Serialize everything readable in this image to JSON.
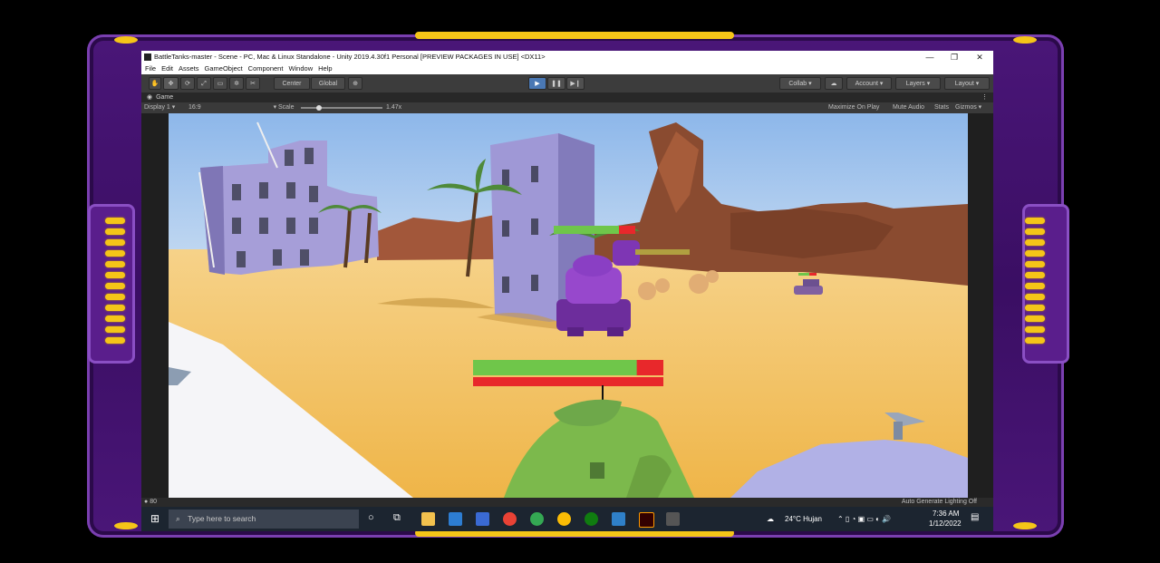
{
  "window": {
    "title": "BattleTanks-master - Scene - PC, Mac & Linux Standalone - Unity 2019.4.30f1 Personal [PREVIEW PACKAGES IN USE] <DX11>",
    "minimize": "—",
    "maximize": "❐",
    "close": "✕"
  },
  "menu": [
    "File",
    "Edit",
    "Assets",
    "GameObject",
    "Component",
    "Window",
    "Help"
  ],
  "toolbar": {
    "pivot_center": "Center",
    "pivot_global": "Global",
    "collab": "Collab",
    "account": "Account",
    "layers": "Layers",
    "layout": "Layout"
  },
  "game_view": {
    "tab_label": "Game",
    "display": "Display 1",
    "aspect": "16:9",
    "scale_label": "Scale",
    "scale_value": "1.47x",
    "maximize_on_play": "Maximize On Play",
    "mute_audio": "Mute Audio",
    "stats": "Stats",
    "gizmos": "Gizmos"
  },
  "hud": {
    "player_health_fraction": 0.86,
    "enemy_health_fraction": 0.8
  },
  "status": {
    "count": "80",
    "lighting": "Auto Generate Lighting Off"
  },
  "taskbar": {
    "search_placeholder": "Type here to search",
    "weather": "24°C  Hujan",
    "time": "7:36 AM",
    "date": "1/12/2022"
  },
  "colors": {
    "frame_purple": "#4a1678",
    "frame_gold": "#f5c518",
    "sky": "#9fc3ee",
    "sand": "#f3c56a",
    "health_green": "#6fc64a",
    "health_red": "#e8282b",
    "tank_green": "#7cb94c",
    "tank_purple": "#8a3fc4"
  }
}
